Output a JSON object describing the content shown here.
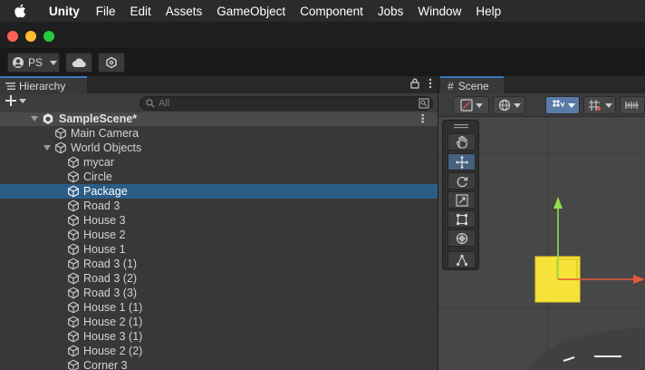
{
  "menubar": {
    "apple_icon": "apple-logo",
    "items": [
      "Unity",
      "File",
      "Edit",
      "Assets",
      "GameObject",
      "Component",
      "Jobs",
      "Window",
      "Help"
    ]
  },
  "toolbar": {
    "account_label": "PS",
    "cloud_icon": "cloud-icon",
    "collab_icon": "collab-icon"
  },
  "hierarchy": {
    "tab_label": "Hierarchy",
    "search_placeholder": "All",
    "scene_name": "SampleScene*",
    "rows": [
      {
        "label": "Main Camera",
        "depth": 1,
        "selected": false,
        "expandable": false
      },
      {
        "label": "World Objects",
        "depth": 1,
        "selected": false,
        "expandable": true
      },
      {
        "label": "mycar",
        "depth": 2,
        "selected": false,
        "expandable": false
      },
      {
        "label": "Circle",
        "depth": 2,
        "selected": false,
        "expandable": false
      },
      {
        "label": "Package",
        "depth": 2,
        "selected": true,
        "expandable": false
      },
      {
        "label": "Road 3",
        "depth": 2,
        "selected": false,
        "expandable": false
      },
      {
        "label": "House 3",
        "depth": 2,
        "selected": false,
        "expandable": false
      },
      {
        "label": "House 2",
        "depth": 2,
        "selected": false,
        "expandable": false
      },
      {
        "label": "House 1",
        "depth": 2,
        "selected": false,
        "expandable": false
      },
      {
        "label": "Road 3 (1)",
        "depth": 2,
        "selected": false,
        "expandable": false
      },
      {
        "label": "Road 3 (2)",
        "depth": 2,
        "selected": false,
        "expandable": false
      },
      {
        "label": "Road 3 (3)",
        "depth": 2,
        "selected": false,
        "expandable": false
      },
      {
        "label": "House 1 (1)",
        "depth": 2,
        "selected": false,
        "expandable": false
      },
      {
        "label": "House 2 (1)",
        "depth": 2,
        "selected": false,
        "expandable": false
      },
      {
        "label": "House 3 (1)",
        "depth": 2,
        "selected": false,
        "expandable": false
      },
      {
        "label": "House 2 (2)",
        "depth": 2,
        "selected": false,
        "expandable": false
      },
      {
        "label": "Corner 3",
        "depth": 2,
        "selected": false,
        "expandable": false
      }
    ]
  },
  "scene": {
    "tab_label": "Scene",
    "tools": [
      "hand-tool",
      "move-tool",
      "rotate-tool",
      "scale-tool",
      "rect-tool",
      "transform-tool",
      "custom-tool"
    ],
    "active_tool": "move-tool",
    "colors": {
      "selected_object": "#f7e23a",
      "gizmo_y": "#8fe04a",
      "gizmo_x": "#e8583a",
      "selection_highlight": "#2c5d87"
    }
  }
}
